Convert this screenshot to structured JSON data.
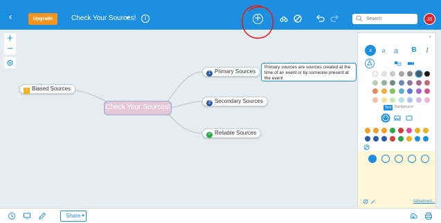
{
  "topbar": {
    "back_icon": "chevron-left-icon",
    "upgrade_label": "Upgrade",
    "title": "Check Your Sources!",
    "info_icon": "info-icon",
    "add_icon": "plus-circle-icon",
    "undo_icon": "undo-icon",
    "redo_icon": "redo-icon",
    "search_placeholder": "Search",
    "avatar_initials": "JS",
    "brand_color": "#1d8fe0",
    "upgrade_color": "#f7941d",
    "avatar_color": "#d9232f"
  },
  "map": {
    "central": "Check Your Sources!",
    "central_color": "#e7c6d9",
    "nodes": [
      {
        "label": "Biased Sources",
        "icon": "warning-icon",
        "icon_text": "!"
      },
      {
        "label": "Primary Sources",
        "icon": "number-1-icon",
        "icon_text": "1"
      },
      {
        "label": "Secondary Sources",
        "icon": "number-2-icon",
        "icon_text": "2"
      },
      {
        "label": "Reliable Sources",
        "icon": "check-circle-icon",
        "icon_text": "✓"
      }
    ],
    "note": "Primary sources are sources created at the time of an event or by someone present at the event"
  },
  "panel": {
    "font_buttons": [
      "a",
      "a",
      "a",
      "B",
      "I"
    ],
    "tabs": [
      "Text",
      "Background"
    ],
    "advanced_label": "Advanced...",
    "swatch_colors": [
      "#ffffff",
      "#e0e0e0",
      "#c8c8c8",
      "#a8a8a8",
      "#888888",
      "#585858",
      "#1a1a1a",
      "#b8d0b0",
      "#8fb39a",
      "#6d8f7e",
      "#6a8aa8",
      "#8f77a8",
      "#a8668f",
      "#c06a7a",
      "#e88a5c",
      "#f0b040",
      "#88c060",
      "#5ab0d0",
      "#5a78d0",
      "#a06ad0",
      "#d05a8a",
      "#f4c0a8",
      "#f6e0a0",
      "#c8e8b0",
      "#b0e0e8",
      "#b0c0f0",
      "#d8b8f0",
      "#f0b8d0"
    ],
    "emoji_colors": [
      "#f0a020",
      "#f0a020",
      "#f0a020",
      "#2aa84a",
      "#d93a3a",
      "#e84a9a",
      "#f0b020",
      "#f0b020",
      "#2b5aa8",
      "#2b5aa8",
      "#2b5aa8",
      "#d93a3a",
      "#2aa84a",
      "#f0b020",
      "#1d8fe0",
      "#1d8fe0"
    ]
  },
  "bottombar": {
    "share_label": "Share",
    "history_icon": "history-icon",
    "present_icon": "present-icon",
    "edit_icon": "pencil-icon",
    "download_icon": "download-icon",
    "print_icon": "print-icon"
  }
}
